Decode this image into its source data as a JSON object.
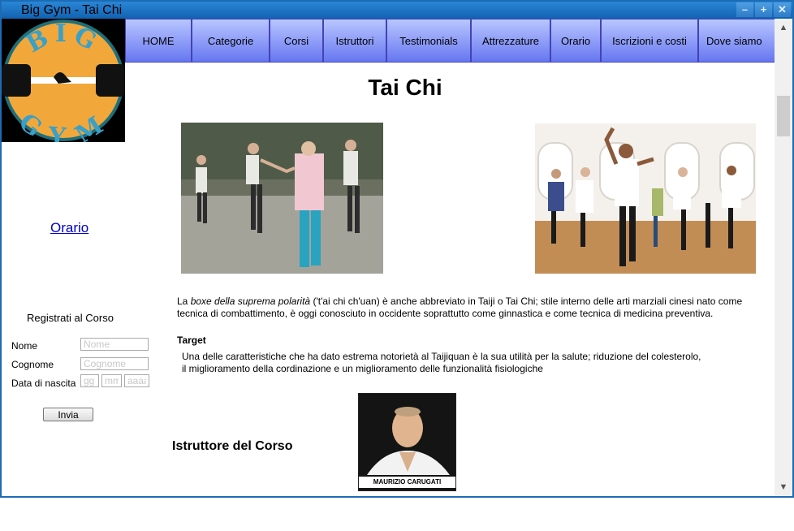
{
  "window": {
    "title": "Big Gym - Tai Chi"
  },
  "logo": {
    "text_top": "BIG",
    "text_bottom": "GYM"
  },
  "nav": {
    "items": [
      "HOME",
      "Categorie",
      "Corsi",
      "Istruttori",
      "Testimonials",
      "Attrezzature",
      "Orario",
      "Iscrizioni e costi",
      "Dove siamo"
    ]
  },
  "page": {
    "title": "Tai Chi"
  },
  "sidebar": {
    "orario_link": "Orario",
    "form": {
      "title": "Registrati al Corso",
      "nome_label": "Nome",
      "nome_placeholder": "Nome",
      "cognome_label": "Cognome",
      "cognome_placeholder": "Cognome",
      "nascita_label": "Data di nascita",
      "gg_placeholder": "gg",
      "mm_placeholder": "mm",
      "aaaa_placeholder": "aaaa",
      "submit_label": "Invia"
    }
  },
  "content": {
    "desc_pre": "La ",
    "desc_italic": "boxe della suprema polarità",
    "desc_post": " ('t'ai chi ch'uan) è anche abbreviato in Taiji o Tai Chi; stile interno delle arti marziali cinesi nato come tecnica di combattimento, è oggi conosciuto in occidente soprattutto come ginnastica e come tecnica di medicina preventiva.",
    "target_title": "Target",
    "target_line1": "Una delle caratteristiche che ha dato estrema notorietà al Taijiquan è la sua utilità per la salute; riduzione del colesterolo,",
    "target_line2": "il miglioramento della cordinazione e un miglioramento delle funzionalità fisiologiche",
    "instructor_title": "Istruttore del Corso",
    "instructor_caption": "MAURIZIO CARUGATI"
  }
}
